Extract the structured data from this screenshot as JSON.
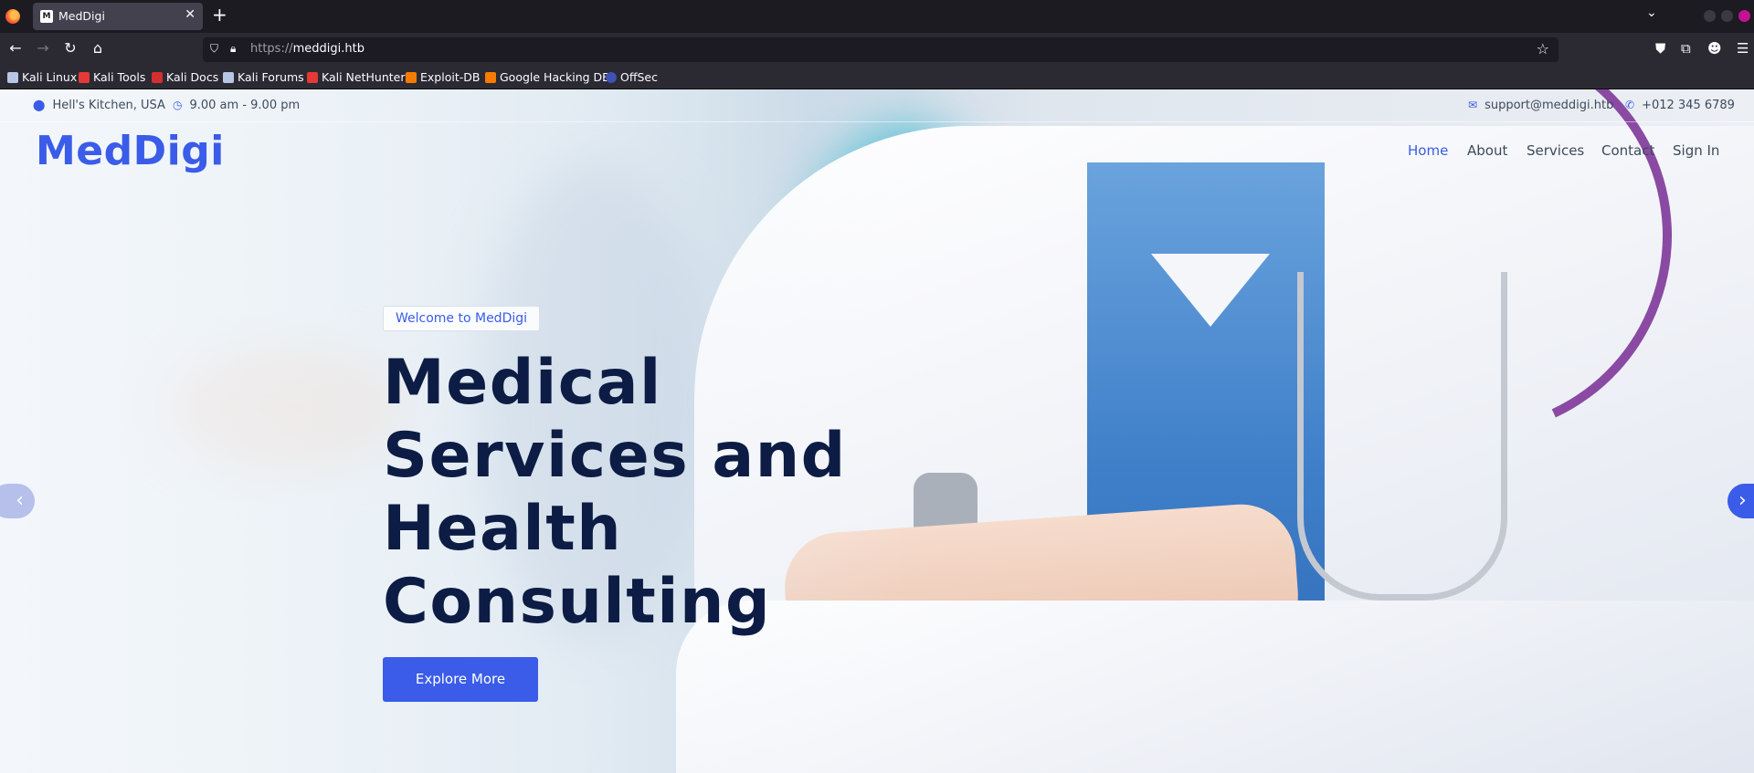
{
  "browser": {
    "tab_title": "MedDigi",
    "tab_favicon": "M",
    "url_scheme": "https://",
    "url_host": "meddigi.htb",
    "bookmarks": [
      {
        "label": "Kali Linux",
        "color": "#367bf0"
      },
      {
        "label": "Kali Tools",
        "color": "#e53935"
      },
      {
        "label": "Kali Docs",
        "color": "#d32f2f"
      },
      {
        "label": "Kali Forums",
        "color": "#367bf0"
      },
      {
        "label": "Kali NetHunter",
        "color": "#e53935"
      },
      {
        "label": "Exploit-DB",
        "color": "#f57c00"
      },
      {
        "label": "Google Hacking DB",
        "color": "#f57c00"
      },
      {
        "label": "OffSec",
        "color": "#3f51b5"
      }
    ]
  },
  "topbar": {
    "location": "Hell's Kitchen, USA",
    "hours": "9.00 am - 9.00 pm",
    "email": "support@meddigi.htb",
    "phone": "+012 345 6789"
  },
  "header": {
    "logo": "MedDigi",
    "menu": [
      "Home",
      "About",
      "Services",
      "Contact",
      "Sign In"
    ],
    "active": "Home"
  },
  "hero": {
    "badge": "Welcome to MedDigi",
    "headline": "Medical Services and Health Consulting",
    "cta": "Explore More"
  },
  "icons": {
    "location": "map-pin-icon",
    "hours": "clock-icon",
    "email": "envelope-icon",
    "phone": "phone-icon",
    "prev": "chevron-left-icon",
    "next": "chevron-right-icon"
  },
  "colors": {
    "accent": "#3a5ce8",
    "headline": "#0c1c44"
  }
}
